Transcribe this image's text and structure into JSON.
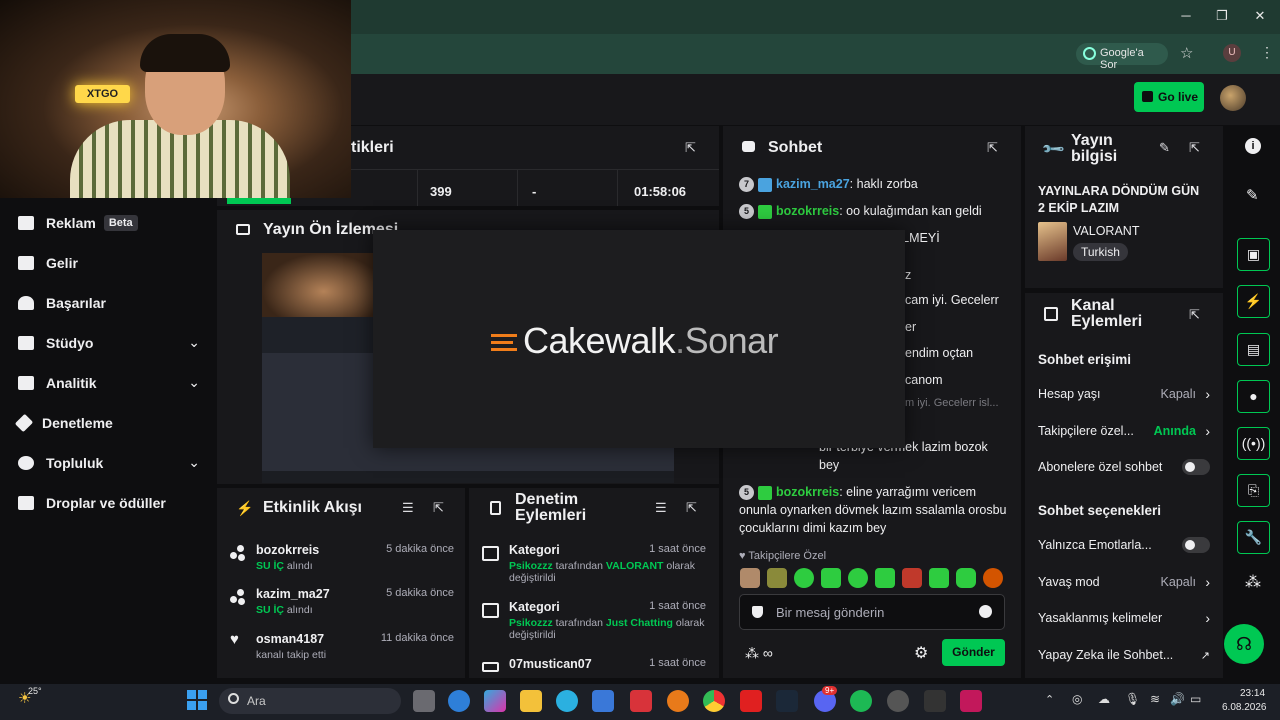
{
  "browser": {
    "google_button": "Google'a Sor",
    "user_initial": "U"
  },
  "webcam": {
    "neon_text": "XTGO"
  },
  "topbar": {
    "go_live": "Go live"
  },
  "sidebar": {
    "items": [
      {
        "label": "Reklam",
        "badge": "Beta"
      },
      {
        "label": "Gelir"
      },
      {
        "label": "Başarılar"
      },
      {
        "label": "Stüdyo"
      },
      {
        "label": "Analitik"
      },
      {
        "label": "Denetleme"
      },
      {
        "label": "Topluluk"
      },
      {
        "label": "Droplar ve ödüller"
      }
    ]
  },
  "stats": {
    "title_partial": "tikleri",
    "values": [
      "399",
      "-",
      "01:58:06"
    ]
  },
  "preview": {
    "title": "Yayın Ön İzlemesi"
  },
  "overlay": {
    "brand": "Cakewalk",
    "product": "Sonar"
  },
  "chat": {
    "title": "Sohbet",
    "messages": [
      {
        "badge": "7",
        "user": "kazim_ma27",
        "text": ": haklı zorba",
        "color": "#4aa3df"
      },
      {
        "badge": "5",
        "user": "bozokrreis",
        "text": ": oo kulağımdan kan geldi",
        "color": "#2ecc40"
      },
      {
        "badge": "",
        "user": "",
        "text": "A GELMEYİ",
        "color": "#2ecc40"
      },
      {
        "badge": "",
        "user": "",
        "text": "z",
        "color": ""
      },
      {
        "badge": "",
        "user": "",
        "text": "cam iyi. Gecelerr",
        "color": ""
      },
      {
        "badge": "",
        "user": "",
        "text": "er",
        "color": ""
      },
      {
        "badge": "",
        "user": "",
        "text": "endim oçtan",
        "color": ""
      },
      {
        "badge": "",
        "user": "",
        "text": "canom",
        "color": ""
      },
      {
        "badge": "",
        "user": "",
        "text": "m iyi. Gecelerr isl...",
        "color": ""
      },
      {
        "badge": "",
        "user": "",
        "text": "bir terbiye vermek lazim bozok bey",
        "color": ""
      },
      {
        "badge": "5",
        "user": "bozokrreis",
        "text": ": eline yarrağımı vericem onunla oynarken dövmek lazım ssalamla orosbu çocuklarını dimi kazım bey",
        "color": "#2ecc40"
      }
    ],
    "followers_only": "Takipçilere Özel",
    "input_placeholder": "Bir mesaj gönderin",
    "send": "Gönder"
  },
  "activity": {
    "title": "Etkinlik Akışı",
    "items": [
      {
        "user": "bozokrreis",
        "time": "5 dakika önce",
        "highlight": "SU İÇ",
        "rest": " alındı"
      },
      {
        "user": "kazim_ma27",
        "time": "5 dakika önce",
        "highlight": "SU İÇ",
        "rest": " alındı"
      },
      {
        "user": "osman4187",
        "time": "11 dakika önce",
        "highlight": "",
        "rest": "kanalı takip etti"
      }
    ]
  },
  "moderation": {
    "title_line1": "Denetim",
    "title_line2": "Eylemleri",
    "items": [
      {
        "title": "Kategori",
        "time": "1 saat önce",
        "actor": "Psikozzz",
        "mid": " tarafından ",
        "value": "VALORANT",
        "end": " olarak değiştirildi"
      },
      {
        "title": "Kategori",
        "time": "1 saat önce",
        "actor": "Psikozzz",
        "mid": " tarafından ",
        "value": "Just Chatting",
        "end": " olarak değiştirildi"
      },
      {
        "title": "07mustican07",
        "time": "1 saat önce",
        "actor": "",
        "mid": "",
        "value": "",
        "end": ""
      }
    ]
  },
  "stream_info": {
    "title_line1": "Yayın",
    "title_line2": "bilgisi",
    "stream_title": "YAYINLARA DÖNDÜM GÜN 2 EKİP LAZIM",
    "game": "VALORANT",
    "language": "Turkish"
  },
  "channel_actions": {
    "title_line1": "Kanal",
    "title_line2": "Eylemleri",
    "chat_access": "Sohbet erişimi",
    "account_age": {
      "label": "Hesap yaşı",
      "value": "Kapalı"
    },
    "followers": {
      "label": "Takipçilere özel...",
      "value": "Anında"
    },
    "subs": {
      "label": "Abonelere özel sohbet"
    },
    "chat_options": "Sohbet seçenekleri",
    "emotes": {
      "label": "Yalnızca Emotlarla..."
    },
    "slow": {
      "label": "Yavaş mod",
      "value": "Kapalı"
    },
    "banned": {
      "label": "Yasaklanmış kelimeler"
    },
    "ai": {
      "label": "Yapay Zeka ile Sohbet..."
    }
  },
  "taskbar": {
    "weather": "25°",
    "search": "Ara",
    "time": "23:14",
    "date": "6.08.2026",
    "discord_badge": "9+"
  },
  "colors": {
    "accent": "#00c853",
    "panel": "#18181b",
    "bg": "#0e0e10"
  }
}
